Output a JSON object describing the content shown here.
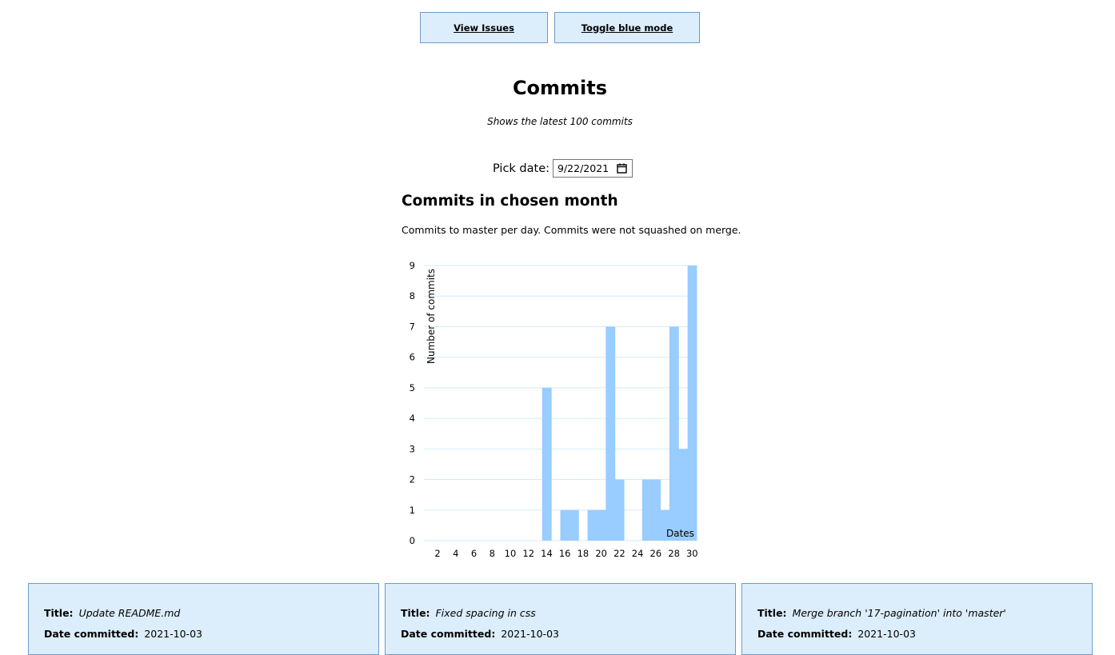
{
  "nav": {
    "issues_label": "View Issues",
    "toggle_label": "Toggle blue mode"
  },
  "page": {
    "title": "Commits",
    "subtitle": "Shows the latest 100 commits"
  },
  "date_picker": {
    "label": "Pick date:",
    "value": "9/22/2021",
    "icon": "calendar-icon"
  },
  "section": {
    "title": "Commits in chosen month",
    "description": "Commits to master per day. Commits were not squashed on merge."
  },
  "chart_data": {
    "type": "bar",
    "x": [
      1,
      2,
      3,
      4,
      5,
      6,
      7,
      8,
      9,
      10,
      11,
      12,
      13,
      14,
      15,
      16,
      17,
      18,
      19,
      20,
      21,
      22,
      23,
      24,
      25,
      26,
      27,
      28,
      29,
      30
    ],
    "values": [
      0,
      0,
      0,
      0,
      0,
      0,
      0,
      0,
      0,
      0,
      0,
      0,
      0,
      5,
      0,
      1,
      1,
      0,
      1,
      1,
      7,
      2,
      0,
      0,
      2,
      2,
      1,
      7,
      3,
      9
    ],
    "x_ticks": [
      "2",
      "4",
      "6",
      "8",
      "10",
      "12",
      "14",
      "16",
      "18",
      "20",
      "22",
      "24",
      "26",
      "28",
      "30"
    ],
    "y_ticks": [
      "0",
      "1",
      "2",
      "3",
      "4",
      "5",
      "6",
      "7",
      "8",
      "9"
    ],
    "ylim": [
      0,
      9
    ],
    "xlabel": "Dates",
    "ylabel": "Number of commits",
    "bar_color": "#99ccff",
    "grid_color": "#d3edf3",
    "grid": true
  },
  "commits": [
    {
      "title_label": "Title:",
      "title": "Update README.md",
      "date_label": "Date committed:",
      "date": "2021-10-03"
    },
    {
      "title_label": "Title:",
      "title": "Fixed spacing in css",
      "date_label": "Date committed:",
      "date": "2021-10-03"
    },
    {
      "title_label": "Title:",
      "title": "Merge branch '17-pagination' into 'master'",
      "date_label": "Date committed:",
      "date": "2021-10-03"
    }
  ]
}
